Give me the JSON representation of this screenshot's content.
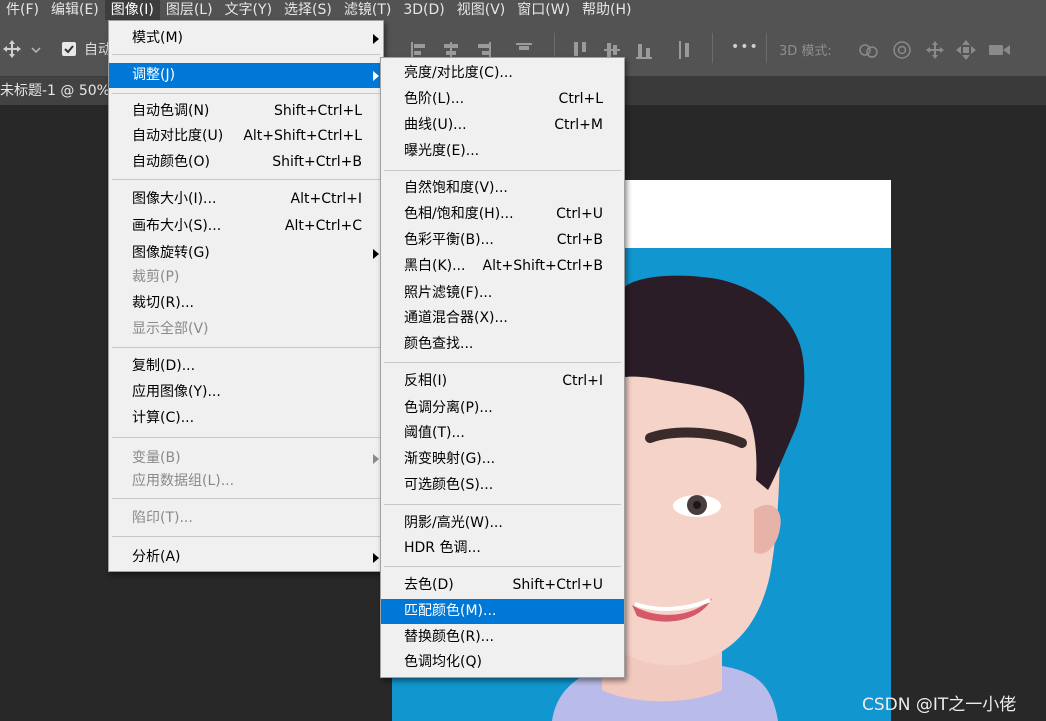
{
  "menubar": {
    "items": [
      "件(F)",
      "编辑(E)",
      "图像(I)",
      "图层(L)",
      "文字(Y)",
      "选择(S)",
      "滤镜(T)",
      "3D(D)",
      "视图(V)",
      "窗口(W)",
      "帮助(H)"
    ],
    "active_index": 2
  },
  "options": {
    "auto_label": "自动",
    "mode_3d_label": "3D 模式:",
    "more_label": "•••"
  },
  "document": {
    "tab_label": "未标题-1 @ 50%("
  },
  "image_menu": [
    {
      "label": "模式(M)",
      "shortcut": "",
      "submenu": true
    },
    {
      "label": "调整(J)",
      "shortcut": "",
      "submenu": true,
      "highlighted": true
    },
    {
      "label": "自动色调(N)",
      "shortcut": "Shift+Ctrl+L"
    },
    {
      "label": "自动对比度(U)",
      "shortcut": "Alt+Shift+Ctrl+L"
    },
    {
      "label": "自动颜色(O)",
      "shortcut": "Shift+Ctrl+B"
    },
    {
      "label": "图像大小(I)...",
      "shortcut": "Alt+Ctrl+I"
    },
    {
      "label": "画布大小(S)...",
      "shortcut": "Alt+Ctrl+C"
    },
    {
      "label": "图像旋转(G)",
      "shortcut": "",
      "submenu": true
    },
    {
      "label": "裁剪(P)",
      "shortcut": "",
      "disabled": true
    },
    {
      "label": "裁切(R)...",
      "shortcut": ""
    },
    {
      "label": "显示全部(V)",
      "shortcut": "",
      "disabled": true
    },
    {
      "label": "复制(D)...",
      "shortcut": ""
    },
    {
      "label": "应用图像(Y)...",
      "shortcut": ""
    },
    {
      "label": "计算(C)...",
      "shortcut": ""
    },
    {
      "label": "变量(B)",
      "shortcut": "",
      "submenu": true,
      "disabled": true
    },
    {
      "label": "应用数据组(L)...",
      "shortcut": "",
      "disabled": true
    },
    {
      "label": "陷印(T)...",
      "shortcut": "",
      "disabled": true
    },
    {
      "label": "分析(A)",
      "shortcut": "",
      "submenu": true
    }
  ],
  "adjust_menu": [
    {
      "label": "亮度/对比度(C)...",
      "shortcut": ""
    },
    {
      "label": "色阶(L)...",
      "shortcut": "Ctrl+L"
    },
    {
      "label": "曲线(U)...",
      "shortcut": "Ctrl+M"
    },
    {
      "label": "曝光度(E)...",
      "shortcut": ""
    },
    {
      "label": "自然饱和度(V)...",
      "shortcut": ""
    },
    {
      "label": "色相/饱和度(H)...",
      "shortcut": "Ctrl+U"
    },
    {
      "label": "色彩平衡(B)...",
      "shortcut": "Ctrl+B"
    },
    {
      "label": "黑白(K)...",
      "shortcut": "Alt+Shift+Ctrl+B"
    },
    {
      "label": "照片滤镜(F)...",
      "shortcut": ""
    },
    {
      "label": "通道混合器(X)...",
      "shortcut": ""
    },
    {
      "label": "颜色查找...",
      "shortcut": ""
    },
    {
      "label": "反相(I)",
      "shortcut": "Ctrl+I"
    },
    {
      "label": "色调分离(P)...",
      "shortcut": ""
    },
    {
      "label": "阈值(T)...",
      "shortcut": ""
    },
    {
      "label": "渐变映射(G)...",
      "shortcut": ""
    },
    {
      "label": "可选颜色(S)...",
      "shortcut": ""
    },
    {
      "label": "阴影/高光(W)...",
      "shortcut": ""
    },
    {
      "label": "HDR 色调...",
      "shortcut": ""
    },
    {
      "label": "去色(D)",
      "shortcut": "Shift+Ctrl+U"
    },
    {
      "label": "匹配颜色(M)...",
      "shortcut": "",
      "highlighted": true
    },
    {
      "label": "替换颜色(R)...",
      "shortcut": ""
    },
    {
      "label": "色调均化(Q)",
      "shortcut": ""
    }
  ],
  "watermark": "CSDN @IT之一小佬",
  "colors": {
    "menubar": "#535353",
    "workspace": "#282828",
    "menu_bg": "#f0f0f0",
    "highlight": "#0078d7",
    "canvas_blue": "#1296cf"
  }
}
